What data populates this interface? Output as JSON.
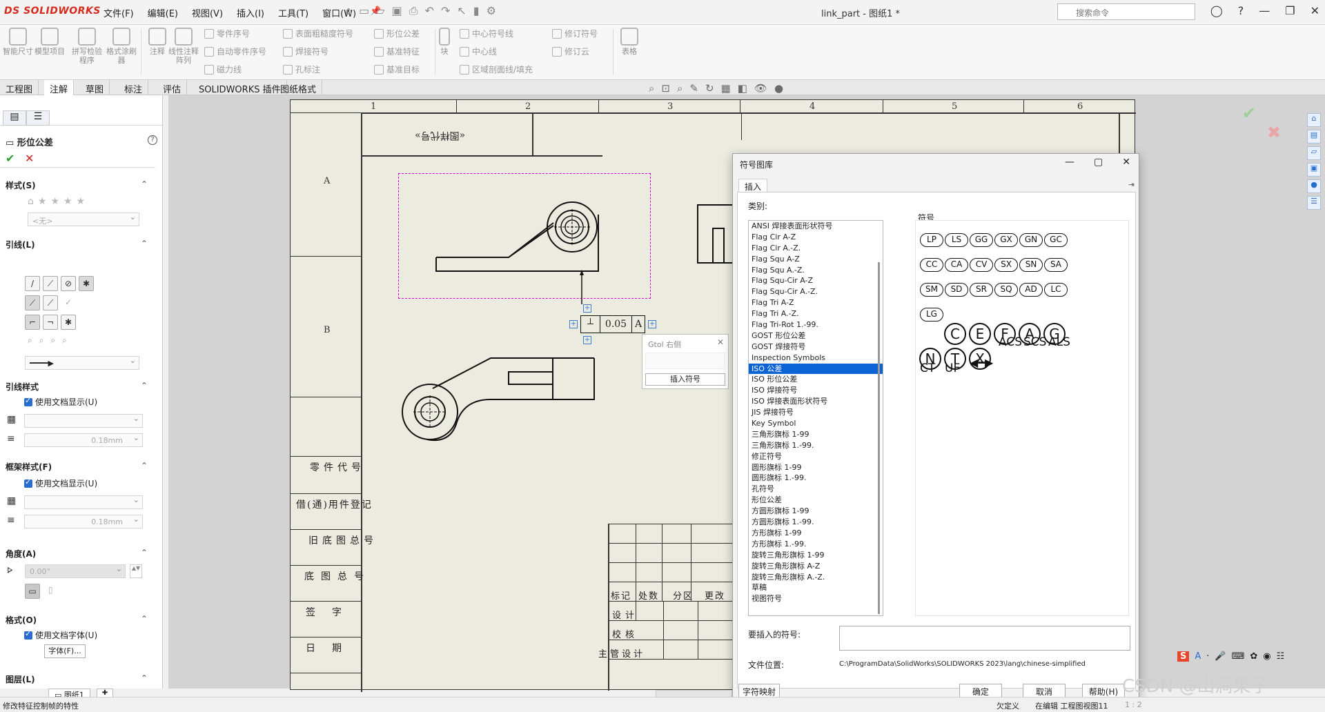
{
  "app": {
    "logo": "SOLIDWORKS",
    "doc_title": "link_part - 图纸1 *",
    "search_placeholder": "搜索命令"
  },
  "menu": [
    "文件(F)",
    "编辑(E)",
    "视图(V)",
    "插入(I)",
    "工具(T)",
    "窗口(W)"
  ],
  "ribbon": {
    "big": [
      "智能尺寸",
      "模型项目",
      "拼写检验程序",
      "格式涂刷器",
      "注释",
      "线性注释阵列"
    ],
    "col1": [
      "零件序号",
      "自动零件序号",
      "磁力线"
    ],
    "col2": [
      "表面粗糙度符号",
      "焊接符号",
      "孔标注"
    ],
    "col3": [
      "形位公差",
      "基准特征",
      "基准目标"
    ],
    "block": "块",
    "col4": [
      "中心符号线",
      "中心线",
      "区域剖面线/填充"
    ],
    "col5": [
      "修订符号",
      "修订云"
    ],
    "table": "表格"
  },
  "tabs": [
    "工程图",
    "注解",
    "草图",
    "标注",
    "评估",
    "SOLIDWORKS 插件",
    "图纸格式"
  ],
  "left_panel": {
    "title": "形位公差",
    "sections": {
      "style": "样式(S)",
      "style_value": "<无>",
      "leader": "引线(L)",
      "leader_style": "引线样式",
      "use_doc": "使用文档显示(U)",
      "line_w": "0.18mm",
      "frame_style": "框架样式(F)",
      "use_doc2": "使用文档显示(U)",
      "line_w2": "0.18mm",
      "angle": "角度(A)",
      "angle_val": "0.00°",
      "format": "格式(O)",
      "use_font": "使用文档字体(U)",
      "font_btn": "字体(F)...",
      "layer": "图层(L)"
    }
  },
  "sheet": {
    "cols": [
      "1",
      "2",
      "3",
      "4",
      "5",
      "6"
    ],
    "rows": [
      "A",
      "B"
    ],
    "stamp": "«图样代号»",
    "gtol_value": "0.05",
    "gtol_datum": "A",
    "title_left": [
      "零件代号",
      "借(通)用件登记",
      "旧底图总号",
      "底图总号",
      "签字",
      "日期"
    ],
    "title_mid": [
      "标记",
      "处数",
      "分区",
      "更改"
    ],
    "title_rows": [
      "设计",
      "校核",
      "主管设计"
    ]
  },
  "gtol_popup": {
    "title": "Gtol 右侧",
    "button": "插入符号"
  },
  "dialog": {
    "title": "符号图库",
    "tab": "插入",
    "category_label": "类别:",
    "categories": [
      "ANSI 焊接表面形状符号",
      "Flag Cir A-Z",
      "Flag Cir A.-Z.",
      "Flag Squ A-Z",
      "Flag Squ A.-Z.",
      "Flag Squ-Cir A-Z",
      "Flag Squ-Cir A.-Z.",
      "Flag Tri A-Z",
      "Flag Tri A.-Z.",
      "Flag Tri-Rot 1.-99.",
      "GOST 形位公差",
      "GOST 焊接符号",
      "Inspection Symbols",
      "ISO 公差",
      "ISO 形位公差",
      "ISO 焊接符号",
      "ISO 焊接表面形状符号",
      "JIS 焊接符号",
      "Key Symbol",
      "三角形旗标 1-99",
      "三角形旗标 1.-99.",
      "修正符号",
      "圆形旗标 1-99",
      "圆形旗标 1.-99.",
      "孔符号",
      "形位公差",
      "方圆形旗标 1-99",
      "方圆形旗标 1.-99.",
      "方形旗标 1-99",
      "方形旗标 1.-99.",
      "旋转三角形旗标 1-99",
      "旋转三角形旗标 A-Z",
      "旋转三角形旗标 A.-Z.",
      "草稿",
      "视图符号"
    ],
    "selected_index": 13,
    "symbol_label": "符号",
    "oval_symbols": [
      "LP",
      "LS",
      "GG",
      "GX",
      "GN",
      "GC",
      "CC",
      "CA",
      "CV",
      "SX",
      "SN",
      "SA",
      "SM",
      "SD",
      "SR",
      "SQ",
      "AD",
      "LC",
      "LG"
    ],
    "circle_symbols": [
      "C",
      "E",
      "F",
      "A",
      "G",
      "N",
      "T",
      "X"
    ],
    "text_symbols": [
      "ACS",
      "SCS",
      "ALS",
      "CT",
      "UF"
    ],
    "insert_label": "要插入的符号:",
    "location_label": "文件位置:",
    "location_value": "C:\\ProgramData\\SolidWorks\\SOLIDWORKS 2023\\lang\\chinese-simplified",
    "buttons": {
      "charmap": "字符映射",
      "ok": "确定",
      "cancel": "取消",
      "help": "帮助(H)"
    }
  },
  "status": {
    "left": "修改特征控制帧的特性",
    "sheet_tab": "图纸1",
    "r1": "欠定义",
    "r2": "在编辑 工程图视图11",
    "scale": "1 : 2"
  },
  "watermark": "CSDN @山涧果子"
}
